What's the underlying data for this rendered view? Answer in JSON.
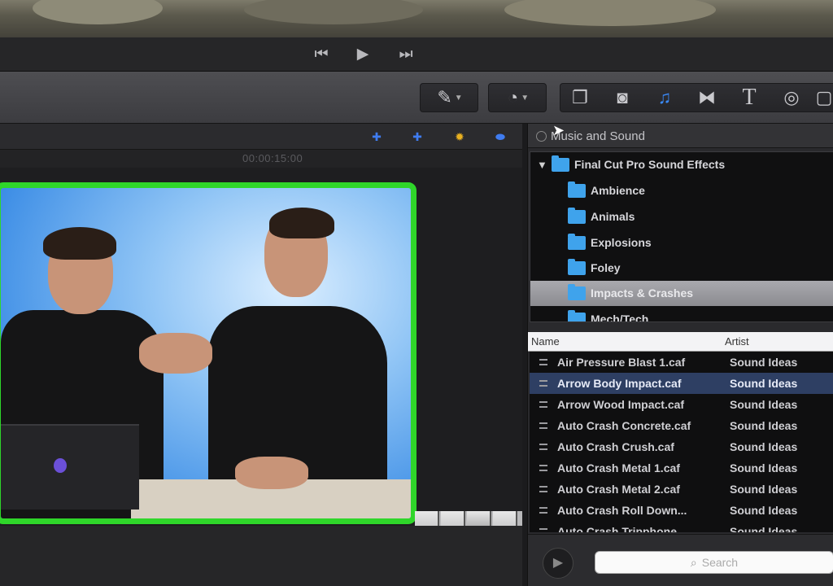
{
  "transport": {
    "prev_icon": "skip-back-icon",
    "play_icon": "play-icon",
    "next_icon": "skip-forward-icon"
  },
  "toolbar": {
    "tools": [
      {
        "name": "magic-wand-icon",
        "glyph": "✎"
      },
      {
        "name": "speed-icon",
        "glyph": "◔"
      },
      {
        "name": "clip-browser-icon",
        "glyph": "❐"
      },
      {
        "name": "camera-icon",
        "glyph": "◙"
      },
      {
        "name": "music-icon",
        "glyph": "♫"
      },
      {
        "name": "transitions-icon",
        "glyph": "⧓"
      },
      {
        "name": "titles-icon",
        "glyph": "T"
      },
      {
        "name": "generators-icon",
        "glyph": "◎"
      }
    ],
    "active_color": "#3b8cff"
  },
  "viewer": {
    "timecode": "00:00:15:00",
    "frame_color": "#2fd62a"
  },
  "browser": {
    "title": "Music and Sound",
    "root_folder": "Final Cut Pro Sound Effects",
    "folders": [
      "Ambience",
      "Animals",
      "Explosions",
      "Foley",
      "Impacts & Crashes",
      "Mech/Tech"
    ],
    "selected_folder": "Impacts & Crashes",
    "columns": {
      "name": "Name",
      "artist": "Artist"
    },
    "rows": [
      {
        "name": "Air Pressure Blast 1.caf",
        "artist": "Sound Ideas"
      },
      {
        "name": "Arrow Body Impact.caf",
        "artist": "Sound Ideas"
      },
      {
        "name": "Arrow Wood Impact.caf",
        "artist": "Sound Ideas"
      },
      {
        "name": "Auto Crash Concrete.caf",
        "artist": "Sound Ideas"
      },
      {
        "name": "Auto Crash Crush.caf",
        "artist": "Sound Ideas"
      },
      {
        "name": "Auto Crash Metal 1.caf",
        "artist": "Sound Ideas"
      },
      {
        "name": "Auto Crash Metal 2.caf",
        "artist": "Sound Ideas"
      },
      {
        "name": "Auto Crash Roll Down...",
        "artist": "Sound Ideas"
      },
      {
        "name": "Auto Crash Tripphone",
        "artist": "Sound Ideas"
      }
    ],
    "selected_row": "Arrow Body Impact.caf",
    "search_placeholder": "Search"
  }
}
